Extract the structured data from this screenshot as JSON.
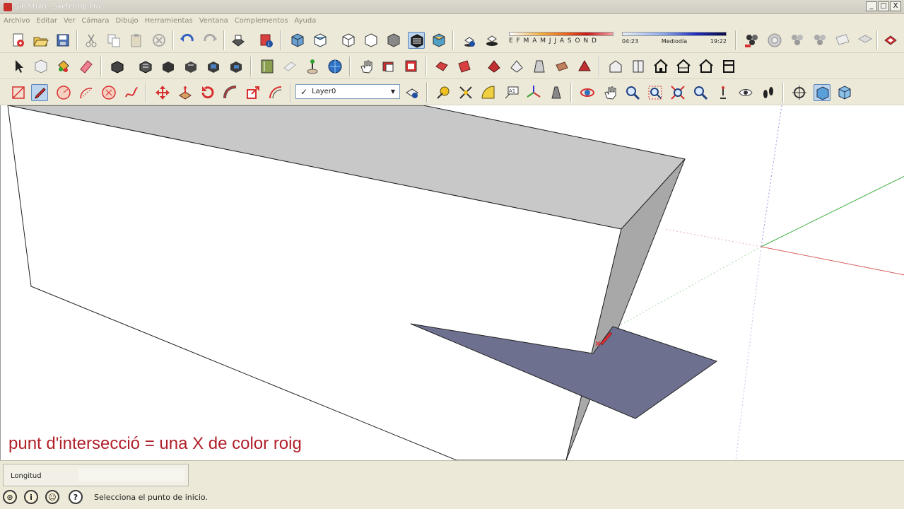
{
  "window": {
    "title": "Sin título - SketchUp Pro",
    "controls": [
      "_",
      "□",
      "X"
    ]
  },
  "menu": [
    "Archivo",
    "Editar",
    "Ver",
    "Cámara",
    "Dibujo",
    "Herramientas",
    "Ventana",
    "Complementos",
    "Ayuda"
  ],
  "shadows": {
    "months": "E F M A M J J A S O N D",
    "time_start": "04:23",
    "time_mid": "Mediodía",
    "time_end": "19:22"
  },
  "layer": {
    "name": "Layer0"
  },
  "colors": {
    "accent": "#b0202a",
    "face_gray": "#c8c8c8",
    "face_dark": "#a8a8a8",
    "plane": "#6e7090",
    "axis_green": "#40b040",
    "axis_red": "#d04040",
    "axis_blue": "#4040d0"
  },
  "toolbar_icons": {
    "row1": [
      "new-icon",
      "open-icon",
      "save-icon",
      "cut-icon",
      "copy-icon",
      "paste-icon",
      "erase-icon",
      "undo-icon",
      "redo-icon",
      "print-icon",
      "model-info-icon",
      "iso-view-icon",
      "top-view-icon",
      "front-view-icon",
      "right-view-icon",
      "back-view-icon",
      "left-view-icon",
      "xray-icon",
      "wireframe-icon",
      "shaded-icon",
      "shadow-settings-icon",
      "fog-icon",
      "components-icon",
      "materials-icon",
      "styles-icon",
      "scenes-icon",
      "photo-textures-icon"
    ],
    "row2": [
      "select-icon",
      "make-component-icon",
      "paint-bucket-icon",
      "eraser-icon",
      "rectangle-icon",
      "line-icon",
      "circle-icon",
      "arc-icon",
      "polygon-icon",
      "freehand-icon",
      "section-plane-icon",
      "text-icon",
      "3d-text-icon",
      "geo-location-icon",
      "sandbox-icon",
      "house-icon"
    ],
    "row3": [
      "rectangle-icon",
      "pencil-icon",
      "circle-icon",
      "arc-icon",
      "polygon-icon",
      "freehand-icon",
      "move-icon",
      "push-pull-icon",
      "rotate-icon",
      "follow-me-icon",
      "scale-icon",
      "offset-icon",
      "tape-measure-icon",
      "dimension-icon",
      "protractor-icon",
      "text-icon",
      "axes-icon",
      "3d-text-icon",
      "orbit-icon",
      "pan-icon",
      "zoom-icon",
      "zoom-window-icon",
      "zoom-extents-icon",
      "previous-view-icon",
      "position-camera-icon",
      "look-around-icon",
      "walk-icon",
      "section-icon",
      "parallel-projection-icon",
      "perspective-icon"
    ]
  },
  "caption": "punt d'intersecció = una X de color roig",
  "vcb": {
    "label": "Longitud",
    "value": ""
  },
  "status": {
    "text": "Selecciona el punto de inicio."
  }
}
